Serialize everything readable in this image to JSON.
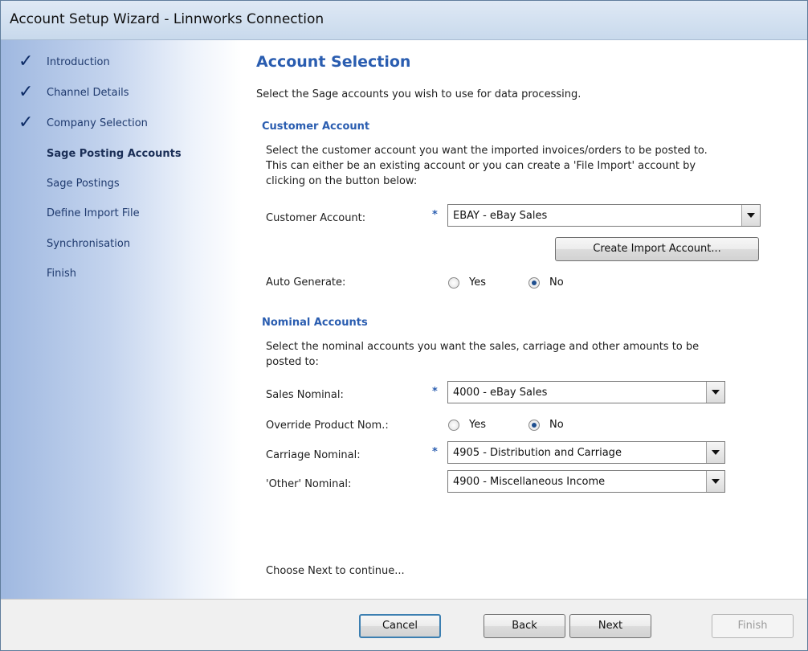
{
  "window": {
    "title": "Account Setup Wizard - Linnworks Connection"
  },
  "sidebar": {
    "steps": [
      {
        "label": "Introduction",
        "done": true
      },
      {
        "label": "Channel Details",
        "done": true
      },
      {
        "label": "Company Selection",
        "done": true
      },
      {
        "label": "Sage Posting Accounts",
        "current": true
      },
      {
        "label": "Sage Postings"
      },
      {
        "label": "Define Import File"
      },
      {
        "label": "Synchronisation"
      },
      {
        "label": "Finish"
      }
    ],
    "check_glyph": "✓"
  },
  "main": {
    "heading": "Account Selection",
    "intro": "Select the Sage accounts you wish to use for data processing.",
    "customer": {
      "title": "Customer Account",
      "desc_line1": "Select the customer account you want the imported invoices/orders to be posted to.",
      "desc_line2": "This can either be an existing account or you can create a 'File Import' account by",
      "desc_line3": "clicking on the button below:",
      "account_label": "Customer Account:",
      "account_value": "EBAY - eBay Sales",
      "create_button": "Create Import Account...",
      "auto_generate_label": "Auto Generate:",
      "yes": "Yes",
      "no": "No",
      "auto_generate_selected": "No"
    },
    "nominal": {
      "title": "Nominal Accounts",
      "desc_line1": "Select the nominal accounts you want the sales, carriage and other amounts to be",
      "desc_line2": "posted to:",
      "sales_label": "Sales Nominal:",
      "sales_value": "4000 - eBay Sales",
      "override_label": "Override Product Nom.:",
      "override_yes": "Yes",
      "override_no": "No",
      "override_selected": "No",
      "carriage_label": "Carriage Nominal:",
      "carriage_value": "4905 - Distribution and Carriage",
      "other_label": "'Other' Nominal:",
      "other_value": "4900 - Miscellaneous Income"
    },
    "required_mark": "*",
    "continue_text": "Choose Next to continue..."
  },
  "footer": {
    "cancel": "Cancel",
    "back": "Back",
    "next": "Next",
    "finish": "Finish"
  },
  "colors": {
    "accent": "#2a5db0",
    "check": "#0d2b66"
  },
  "icons": {
    "dropdown": "chevron-down-icon",
    "check": "checkmark-icon"
  }
}
